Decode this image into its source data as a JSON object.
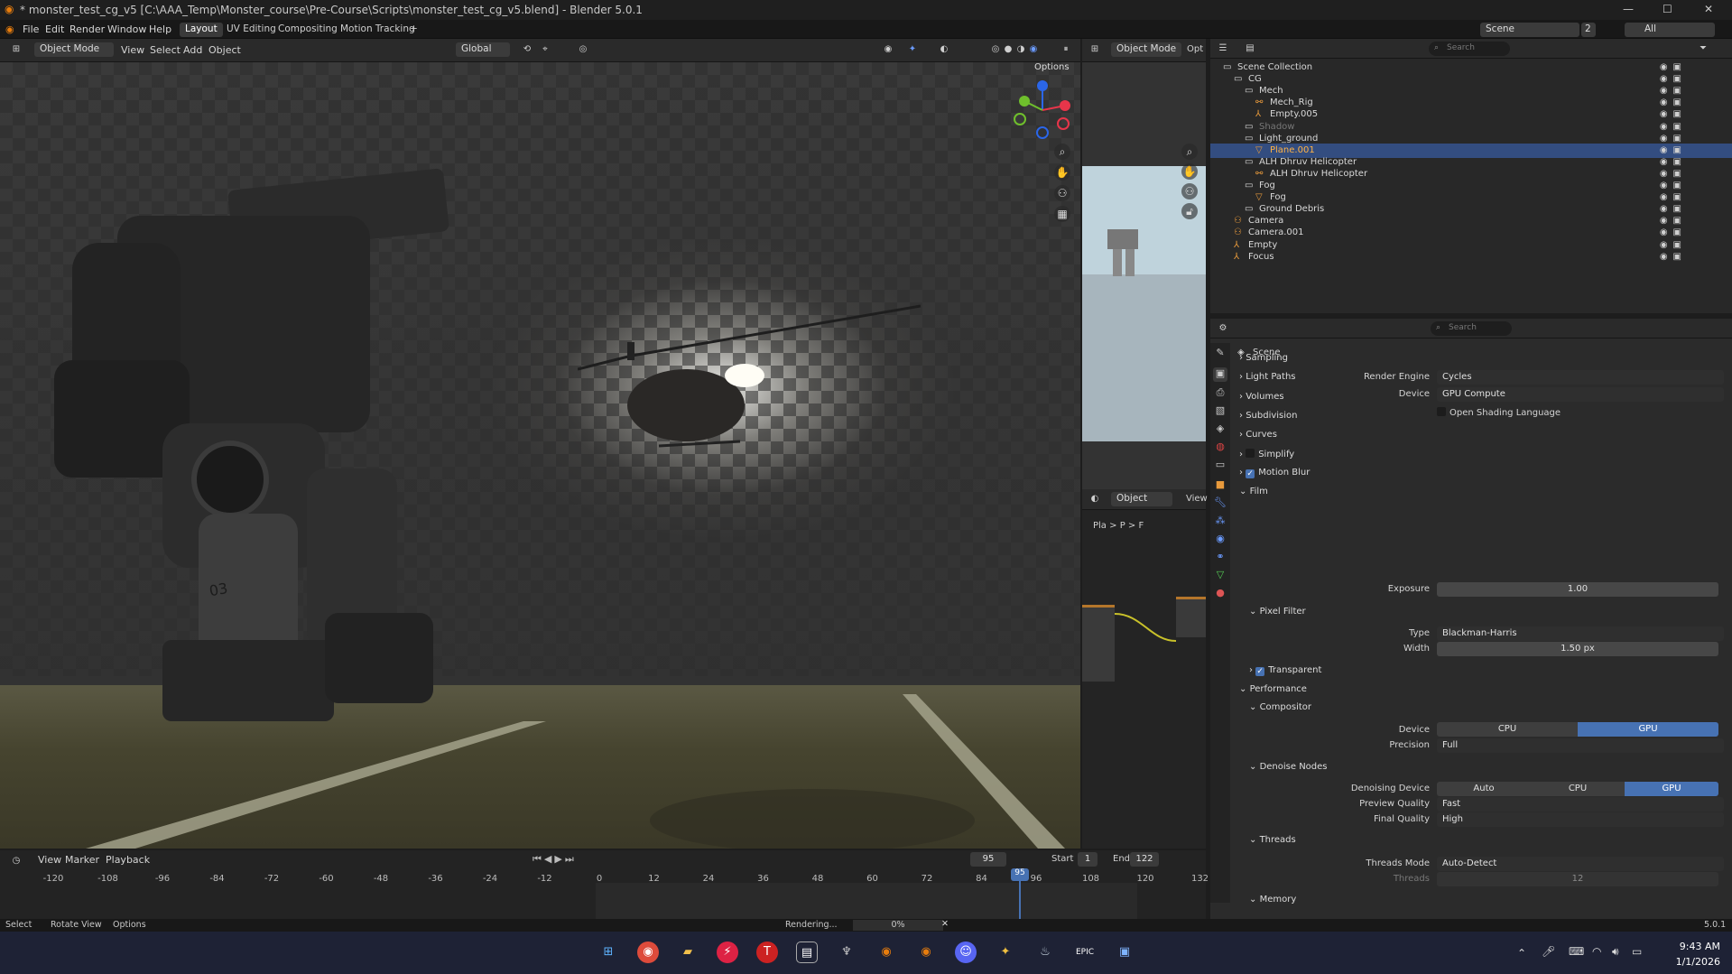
{
  "window": {
    "title": "* monster_test_cg_v5 [C:\\AAA_Temp\\Monster_course\\Pre-Course\\Scripts\\monster_test_cg_v5.blend] - Blender 5.0.1",
    "min": "—",
    "max": "☐",
    "close": "✕"
  },
  "menu": {
    "items": [
      "File",
      "Edit",
      "Render",
      "Window",
      "Help"
    ],
    "workspaces": [
      "Layout",
      "UV Editing",
      "Compositing",
      "Motion Tracking"
    ],
    "add_ws": "+",
    "scene": "Scene",
    "scene_count": "2",
    "view_layer": "All"
  },
  "viewport": {
    "mode": "Object Mode",
    "menus": [
      "View",
      "Select",
      "Add",
      "Object"
    ],
    "transform": "Global",
    "options": "Options"
  },
  "camview": {
    "mode": "Object Mode",
    "options": "Opt"
  },
  "nodeeditor": {
    "mode": "Object",
    "view": "View",
    "breadcrumb": [
      "Pla",
      ">",
      "P",
      "F"
    ]
  },
  "outliner": {
    "search_placeholder": "Search",
    "items": [
      {
        "label": "Scene Collection",
        "indent": 0,
        "kind": "scene"
      },
      {
        "label": "CG",
        "indent": 1,
        "kind": "coll"
      },
      {
        "label": "Mech",
        "indent": 2,
        "kind": "coll"
      },
      {
        "label": "Mech_Rig",
        "indent": 3,
        "kind": "arm"
      },
      {
        "label": "Empty.005",
        "indent": 3,
        "kind": "empty"
      },
      {
        "label": "Shadow",
        "indent": 2,
        "kind": "coll",
        "dim": true
      },
      {
        "label": "Light_ground",
        "indent": 2,
        "kind": "coll"
      },
      {
        "label": "Plane.001",
        "indent": 3,
        "kind": "mesh",
        "selected": true
      },
      {
        "label": "ALH Dhruv Helicopter",
        "indent": 2,
        "kind": "coll"
      },
      {
        "label": "ALH Dhruv Helicopter",
        "indent": 3,
        "kind": "arm"
      },
      {
        "label": "Fog",
        "indent": 2,
        "kind": "coll"
      },
      {
        "label": "Fog",
        "indent": 3,
        "kind": "mesh"
      },
      {
        "label": "Ground Debris",
        "indent": 2,
        "kind": "coll"
      },
      {
        "label": "Camera",
        "indent": 1,
        "kind": "cam"
      },
      {
        "label": "Camera.001",
        "indent": 1,
        "kind": "cam"
      },
      {
        "label": "Empty",
        "indent": 1,
        "kind": "empty"
      },
      {
        "label": "Focus",
        "indent": 1,
        "kind": "empty"
      }
    ]
  },
  "props": {
    "search_placeholder": "Search",
    "context": "Scene",
    "render_engine_label": "Render Engine",
    "render_engine": "Cycles",
    "device_label": "Device",
    "device": "GPU Compute",
    "osl": "Open Shading Language",
    "panels": [
      "Sampling",
      "Light Paths",
      "Volumes",
      "Subdivision",
      "Curves",
      "Simplify",
      "Motion Blur",
      "Film"
    ],
    "exposure_label": "Exposure",
    "exposure": "1.00",
    "pixel_filter": "Pixel Filter",
    "type_label": "Type",
    "type": "Blackman-Harris",
    "width_label": "Width",
    "width": "1.50 px",
    "transparent": "Transparent",
    "performance": "Performance",
    "compositor": "Compositor",
    "comp_device_label": "Device",
    "cpu": "CPU",
    "gpu": "GPU",
    "precision_label": "Precision",
    "precision": "Full",
    "denoise": "Denoise Nodes",
    "denoise_device_label": "Denoising Device",
    "auto": "Auto",
    "preview_quality_label": "Preview Quality",
    "preview_quality": "Fast",
    "final_quality_label": "Final Quality",
    "final_quality": "High",
    "threads": "Threads",
    "threads_mode_label": "Threads Mode",
    "threads_mode": "Auto-Detect",
    "threads_label": "Threads",
    "threads_value": "12",
    "memory": "Memory"
  },
  "timeline": {
    "menus": [
      "View",
      "Marker",
      "Playback"
    ],
    "current_frame": "95",
    "start_label": "Start",
    "start": "1",
    "end_label": "End",
    "end": "122",
    "ticks": [
      "-120",
      "-108",
      "-96",
      "-84",
      "-72",
      "-60",
      "-48",
      "-36",
      "-24",
      "-12",
      "0",
      "12",
      "24",
      "36",
      "48",
      "60",
      "72",
      "84",
      "96",
      "108",
      "120",
      "132"
    ]
  },
  "status": {
    "select": "Select",
    "rotate": "Rotate View",
    "options": "Options",
    "rendering": "Rendering...",
    "percent": "0%",
    "version": "5.0.1"
  },
  "tray": {
    "time": "9:43 AM",
    "date": "1/1/2026"
  },
  "colors": {
    "accent": "#4772b3",
    "selected_row": "#334d80",
    "bg": "#2b2b2b"
  }
}
